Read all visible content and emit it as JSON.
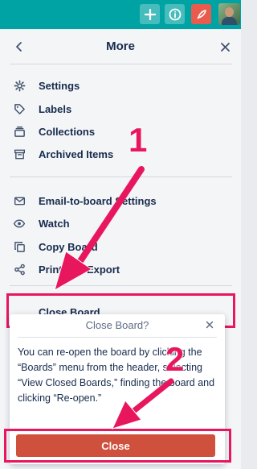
{
  "header": {
    "title": "More"
  },
  "menu": {
    "group1": [
      {
        "label": "Settings",
        "icon": "gear-icon"
      },
      {
        "label": "Labels",
        "icon": "label-icon"
      },
      {
        "label": "Collections",
        "icon": "collections-icon"
      },
      {
        "label": "Archived Items",
        "icon": "archive-icon"
      }
    ],
    "group2": [
      {
        "label": "Email-to-board Settings",
        "icon": "email-icon"
      },
      {
        "label": "Watch",
        "icon": "eye-icon"
      },
      {
        "label": "Copy Board",
        "icon": "copy-icon"
      },
      {
        "label": "Print and Export",
        "icon": "share-icon"
      }
    ],
    "close_board": "Close Board…"
  },
  "dialog": {
    "title": "Close Board?",
    "body": "You can re-open the board by clicking the “Boards” menu from the header, selecting “View Closed Boards,” finding the board and clicking “Re-open.”",
    "close_button": "Close"
  },
  "annotations": {
    "step1": "1",
    "step2": "2",
    "color": "#e8175d"
  },
  "colors": {
    "topbar": "#00a3a3",
    "close_button": "#cf513d",
    "panel": "#f4f5f7"
  }
}
